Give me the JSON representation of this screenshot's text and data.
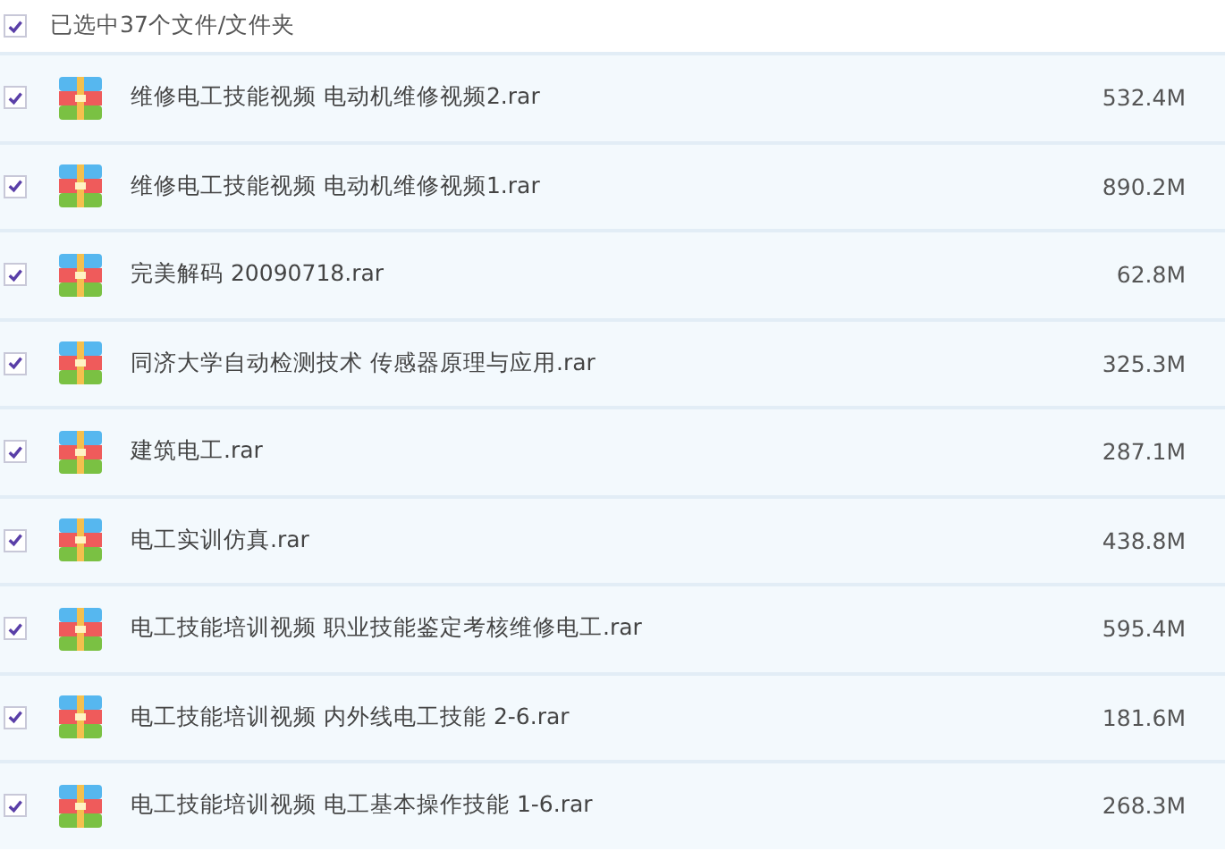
{
  "header": {
    "checked": true,
    "label": "已选中37个文件/文件夹"
  },
  "files": [
    {
      "checked": true,
      "name": "维修电工技能视频 电动机维修视频2.rar",
      "size": "532.4M"
    },
    {
      "checked": true,
      "name": "维修电工技能视频 电动机维修视频1.rar",
      "size": "890.2M"
    },
    {
      "checked": true,
      "name": "完美解码 20090718.rar",
      "size": "62.8M"
    },
    {
      "checked": true,
      "name": "同济大学自动检测技术 传感器原理与应用.rar",
      "size": "325.3M"
    },
    {
      "checked": true,
      "name": "建筑电工.rar",
      "size": "287.1M"
    },
    {
      "checked": true,
      "name": "电工实训仿真.rar",
      "size": "438.8M"
    },
    {
      "checked": true,
      "name": "电工技能培训视频 职业技能鉴定考核维修电工.rar",
      "size": "595.4M"
    },
    {
      "checked": true,
      "name": "电工技能培训视频 内外线电工技能 2-6.rar",
      "size": "181.6M"
    },
    {
      "checked": true,
      "name": "电工技能培训视频 电工基本操作技能 1-6.rar",
      "size": "268.3M"
    }
  ]
}
